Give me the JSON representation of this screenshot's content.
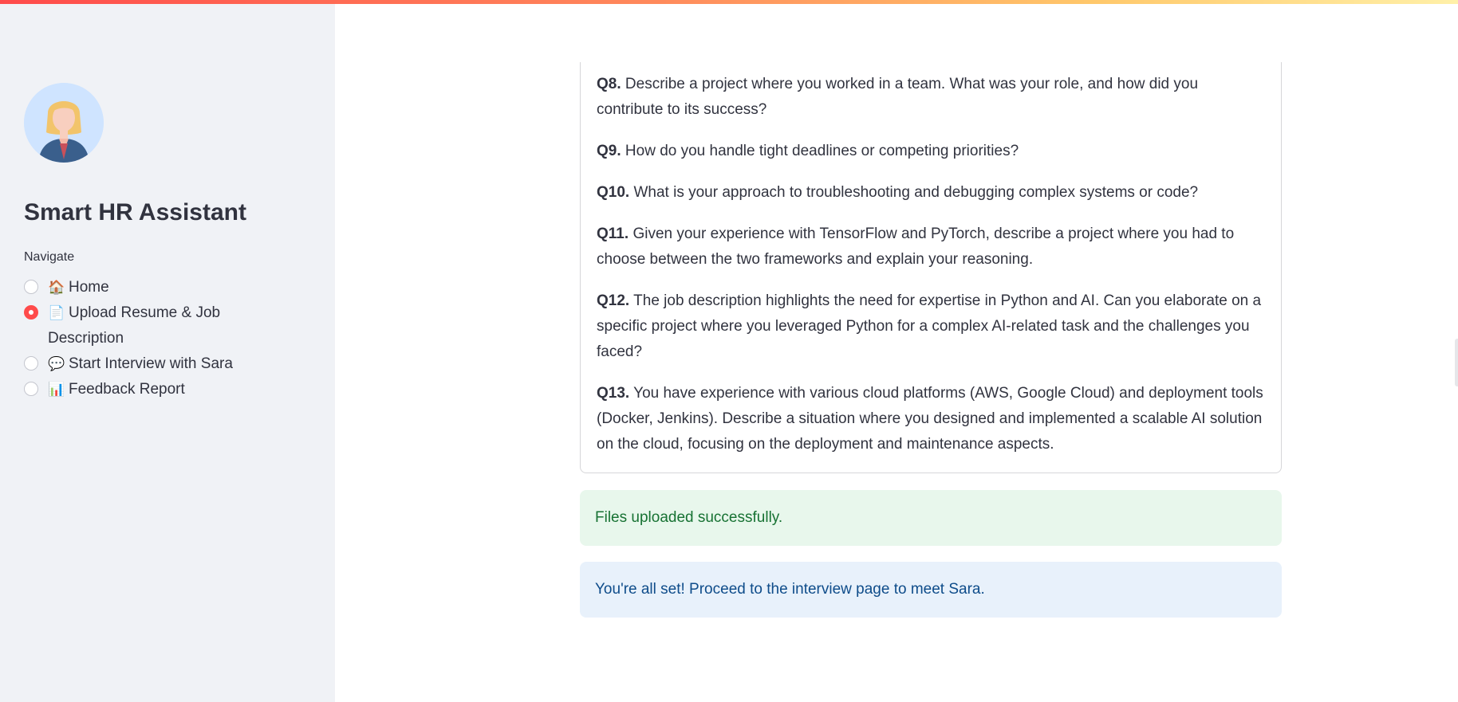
{
  "sidebar": {
    "app_title": "Smart HR Assistant",
    "nav_label": "Navigate",
    "items": [
      {
        "icon": "🏠",
        "icon_name": "home-icon",
        "label": "Home",
        "selected": false
      },
      {
        "icon": "📄",
        "icon_name": "document-icon",
        "label": "Upload Resume & Job Description",
        "selected": true
      },
      {
        "icon": "💬",
        "icon_name": "speech-bubble-icon",
        "label": "Start Interview with Sara",
        "selected": false
      },
      {
        "icon": "📊",
        "icon_name": "bar-chart-icon",
        "label": "Feedback Report",
        "selected": false
      }
    ],
    "accent_color": "#ff4b4b"
  },
  "main": {
    "questions": [
      {
        "num": "Q8.",
        "text": "Describe a project where you worked in a team. What was your role, and how did you contribute to its success?"
      },
      {
        "num": "Q9.",
        "text": "How do you handle tight deadlines or competing priorities?"
      },
      {
        "num": "Q10.",
        "text": "What is your approach to troubleshooting and debugging complex systems or code?"
      },
      {
        "num": "Q11.",
        "text": "Given your experience with TensorFlow and PyTorch, describe a project where you had to choose between the two frameworks and explain your reasoning."
      },
      {
        "num": "Q12.",
        "text": "The job description highlights the need for expertise in Python and AI. Can you elaborate on a specific project where you leveraged Python for a complex AI-related task and the challenges you faced?"
      },
      {
        "num": "Q13.",
        "text": "You have experience with various cloud platforms (AWS, Google Cloud) and deployment tools (Docker, Jenkins). Describe a situation where you designed and implemented a scalable AI solution on the cloud, focusing on the deployment and maintenance aspects."
      }
    ],
    "success_message": "Files uploaded successfully.",
    "info_message": "You're all set! Proceed to the interview page to meet Sara."
  }
}
